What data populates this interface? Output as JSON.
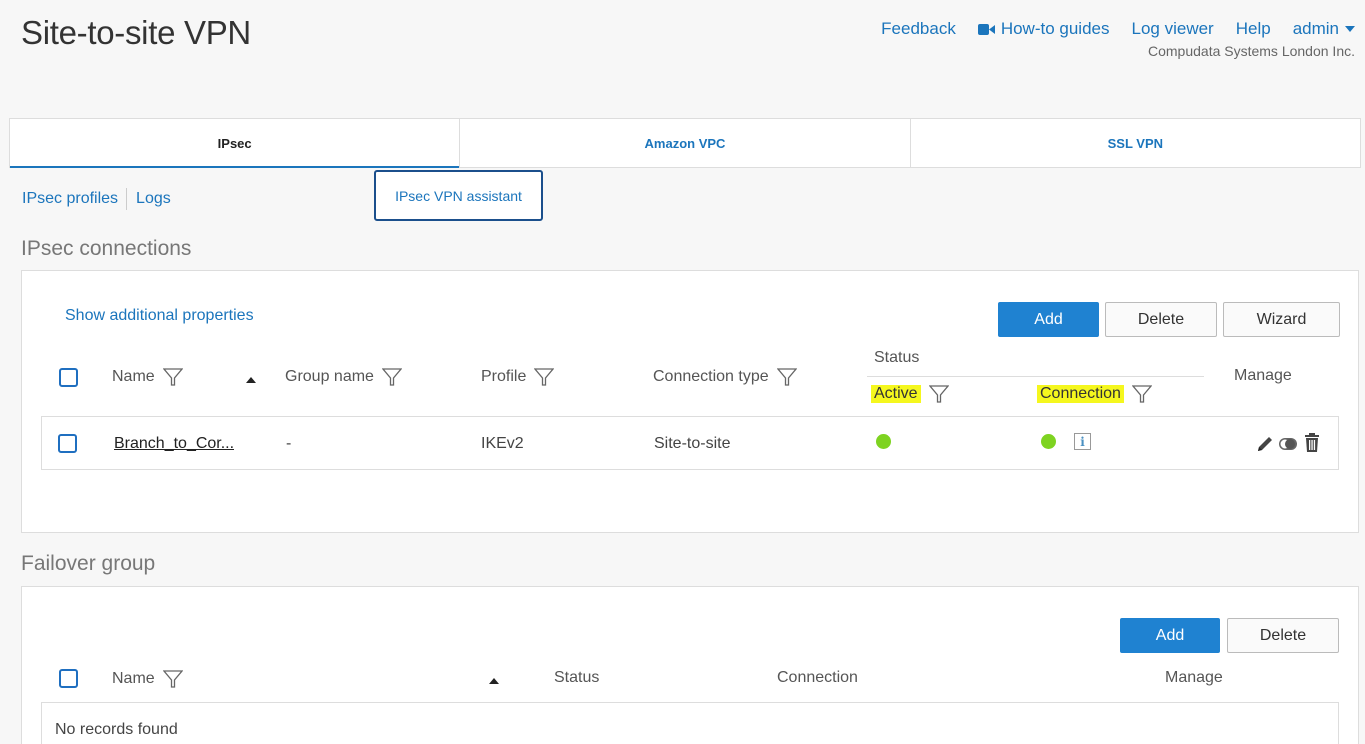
{
  "header": {
    "title": "Site-to-site VPN",
    "nav": {
      "feedback": "Feedback",
      "howto": "How-to guides",
      "logviewer": "Log viewer",
      "help": "Help",
      "admin": "admin"
    },
    "company": "Compudata Systems London Inc."
  },
  "tabs": [
    {
      "label": "IPsec",
      "active": true
    },
    {
      "label": "Amazon VPC",
      "active": false
    },
    {
      "label": "SSL VPN",
      "active": false
    }
  ],
  "sublinks": {
    "profiles": "IPsec profiles",
    "logs": "Logs",
    "assistant": "IPsec VPN assistant"
  },
  "connections": {
    "title": "IPsec connections",
    "show_props": "Show additional properties",
    "buttons": {
      "add": "Add",
      "delete": "Delete",
      "wizard": "Wizard"
    },
    "columns": {
      "name": "Name",
      "group": "Group name",
      "profile": "Profile",
      "conn_type": "Connection type",
      "status": "Status",
      "active": "Active",
      "connection": "Connection",
      "manage": "Manage"
    },
    "rows": [
      {
        "name": "Branch_to_Cor...",
        "group": "-",
        "profile": "IKEv2",
        "conn_type": "Site-to-site",
        "info": "i"
      }
    ]
  },
  "failover": {
    "title": "Failover group",
    "buttons": {
      "add": "Add",
      "delete": "Delete"
    },
    "columns": {
      "name": "Name",
      "status": "Status",
      "connection": "Connection",
      "manage": "Manage"
    },
    "empty": "No records found"
  },
  "colors": {
    "accent": "#1b75bc",
    "primary_button": "#1f82d1",
    "status_green": "#7ed321",
    "highlight": "#f5f71e"
  }
}
